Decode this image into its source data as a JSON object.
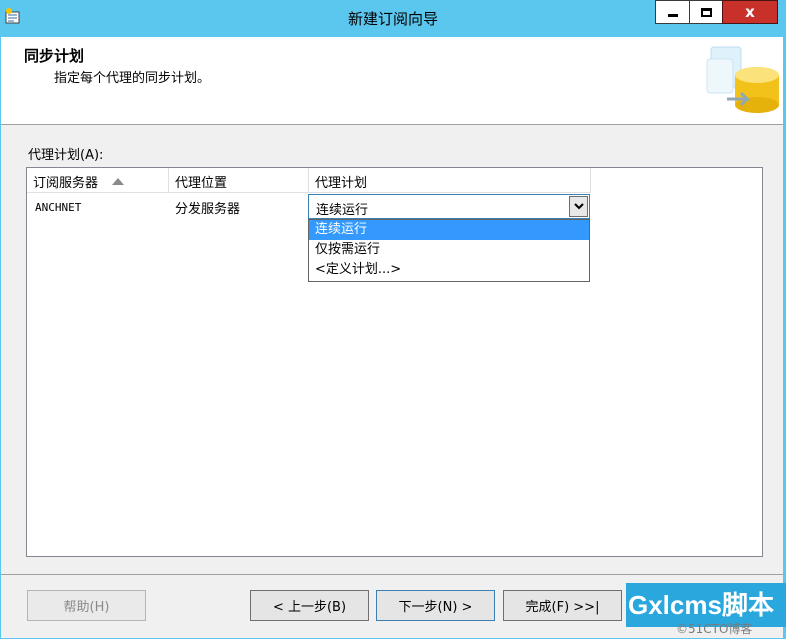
{
  "window": {
    "title": "新建订阅向导",
    "close_glyph": "x"
  },
  "header": {
    "title": "同步计划",
    "subtitle": "指定每个代理的同步计划。",
    "art_icon": "database-wizard-icon"
  },
  "agent_schedule": {
    "label": "代理计划(A):",
    "columns": [
      "订阅服务器",
      "代理位置",
      "代理计划"
    ],
    "rows": [
      {
        "subscriber": "ANCHNET",
        "location": "分发服务器",
        "schedule": "连续运行"
      }
    ],
    "dropdown_options": [
      "连续运行",
      "仅按需运行",
      "<定义计划...>"
    ],
    "selected_option": "连续运行"
  },
  "buttons": {
    "help": "帮助(H)",
    "back": "< 上一步(B)",
    "next": "下一步(N) >",
    "finish": "完成(F) >>|"
  },
  "watermark": {
    "text": "Gxlcms脚本",
    "subtext": "©51CTO博客"
  },
  "colors": {
    "titlebar": "#5bc6ee",
    "close_button": "#c8302a",
    "selection": "#3399ff"
  }
}
